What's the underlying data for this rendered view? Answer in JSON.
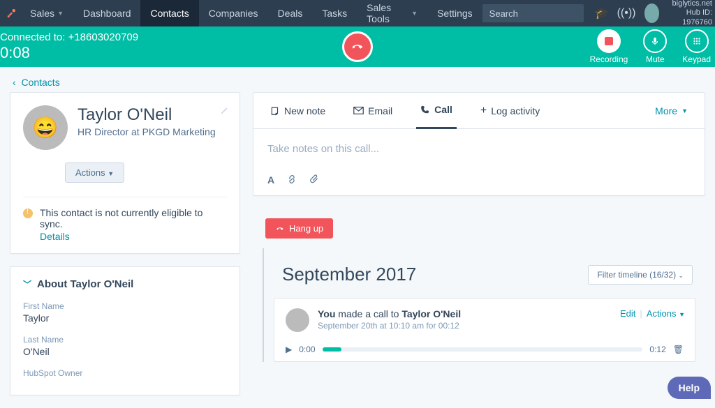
{
  "nav": {
    "brand_section": "Sales",
    "items": [
      "Dashboard",
      "Contacts",
      "Companies",
      "Deals",
      "Tasks",
      "Sales Tools",
      "Settings"
    ],
    "active": 1,
    "has_dropdown": [
      false,
      false,
      false,
      false,
      false,
      true,
      false
    ],
    "search_placeholder": "Search",
    "account_domain": "biglytics.net",
    "hub_id_label": "Hub ID: 1976760"
  },
  "callbar": {
    "connected_label": "Connected to:",
    "phone": "+18603020709",
    "timer": "0:08",
    "controls": {
      "recording": "Recording",
      "mute": "Mute",
      "keypad": "Keypad"
    }
  },
  "crumb_back": "Contacts",
  "contact": {
    "name": "Taylor O'Neil",
    "subtitle": "HR Director at PKGD Marketing",
    "actions_label": "Actions",
    "sync_msg": "This contact is not currently eligible to sync.",
    "details_link": "Details"
  },
  "about": {
    "heading": "About Taylor O'Neil",
    "fields": [
      {
        "label": "First Name",
        "value": "Taylor"
      },
      {
        "label": "Last Name",
        "value": "O'Neil"
      },
      {
        "label": "HubSpot Owner",
        "value": ""
      }
    ]
  },
  "editor": {
    "tabs": [
      "New note",
      "Email",
      "Call",
      "Log activity"
    ],
    "active_tab": 2,
    "more_label": "More",
    "placeholder": "Take notes on this call...",
    "hangup_label": "Hang up"
  },
  "timeline": {
    "month_heading": "September 2017",
    "filter_label": "Filter timeline (16/32)",
    "entry": {
      "actor": "You",
      "verb": " made a call to ",
      "target": "Taylor O'Neil",
      "meta": "September 20th at 10:10 am for 00:12",
      "edit": "Edit",
      "actions": "Actions",
      "play_start": "0:00",
      "play_end": "0:12"
    }
  },
  "help_label": "Help"
}
